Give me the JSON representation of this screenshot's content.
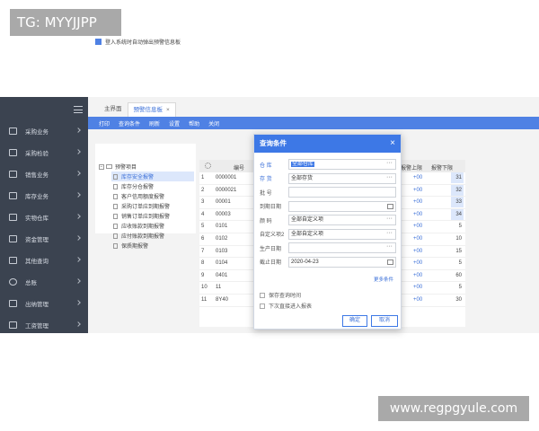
{
  "tag": "TG: MYYJJPP",
  "watermark": "www.regpgyule.com",
  "sidebar": {
    "items": [
      {
        "label": "采购业务"
      },
      {
        "label": "采购检验"
      },
      {
        "label": "销售业务"
      },
      {
        "label": "库存业务"
      },
      {
        "label": "实物仓库"
      },
      {
        "label": "资金管理"
      },
      {
        "label": "其他查询"
      },
      {
        "label": "总账"
      },
      {
        "label": "出纳管理"
      },
      {
        "label": "工资管理"
      }
    ]
  },
  "tabs": [
    {
      "label": "主界面"
    },
    {
      "label": "预警信息板",
      "close": "×"
    }
  ],
  "toolbar": [
    "打印",
    "查询条件",
    "刷新",
    "设置",
    "帮助",
    "关闭"
  ],
  "left_panel": {
    "login_alert": "登入系统时自动弹出预警信息板",
    "tree_root": "预警项目",
    "tree_items": [
      "库存安全报警",
      "库存分仓报警",
      "客户信用额度报警",
      "采购订单应到期报警",
      "销售订单应到期报警",
      "应收账款到期报警",
      "应付账款到期报警",
      "保质期报警"
    ]
  },
  "grid": {
    "col_code": "编号",
    "col_upper": "报警上限",
    "col_lower": "报警下限",
    "rows": [
      {
        "num": "1",
        "code": "0000001",
        "upper": "+00",
        "lower": "31"
      },
      {
        "num": "2",
        "code": "0000021",
        "upper": "+00",
        "lower": "32"
      },
      {
        "num": "3",
        "code": "00001",
        "upper": "+00",
        "lower": "33"
      },
      {
        "num": "4",
        "code": "00003",
        "upper": "+00",
        "lower": "34"
      },
      {
        "num": "5",
        "code": "0101",
        "upper": "+00",
        "lower": "5"
      },
      {
        "num": "6",
        "code": "0102",
        "upper": "+00",
        "lower": "10"
      },
      {
        "num": "7",
        "code": "0103",
        "upper": "+00",
        "lower": "15"
      },
      {
        "num": "8",
        "code": "0104",
        "upper": "+00",
        "lower": "5"
      },
      {
        "num": "9",
        "code": "0401",
        "upper": "+00",
        "lower": "60"
      },
      {
        "num": "10",
        "code": "11",
        "upper": "+00",
        "lower": "5"
      },
      {
        "num": "11",
        "code": "8Y40",
        "upper": "+00",
        "lower": "30"
      }
    ]
  },
  "dialog": {
    "title": "查询条件",
    "close": "×",
    "fields": [
      {
        "label": "仓  库",
        "value": "全部仓库",
        "selected": true,
        "widget": "dots",
        "label_blue": true
      },
      {
        "label": "存  货",
        "value": "全部存货",
        "widget": "dots",
        "label_blue": true
      },
      {
        "label": "批  号",
        "value": "",
        "widget": "none"
      },
      {
        "label": "到期日期",
        "value": "",
        "widget": "cal"
      },
      {
        "label": "颜  码",
        "value": "全部自定义项",
        "widget": "dots"
      },
      {
        "label": "自定义项2",
        "value": "全部自定义项",
        "widget": "dots"
      },
      {
        "label": "生产日期",
        "value": "",
        "widget": "dots"
      },
      {
        "label": "截止日期",
        "value": "2020-04-23",
        "widget": "cal"
      }
    ],
    "more": "更多条件",
    "save_query_time": "保存查询时间",
    "direct_report": "下次直接进入报表",
    "ok": "确定",
    "cancel": "取消"
  }
}
